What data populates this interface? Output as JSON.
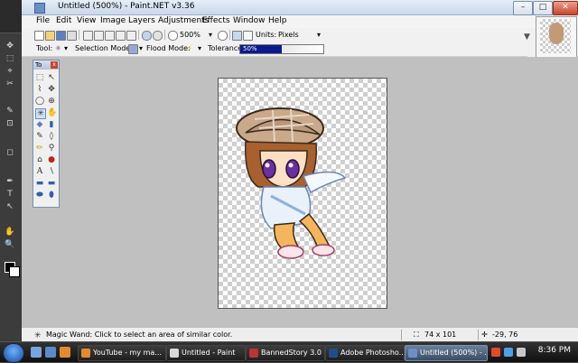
{
  "photoshop": {
    "tools": [
      "✥",
      "⬚",
      "⌖",
      "✂",
      "✎",
      "⊡",
      "◻",
      "✒",
      "T",
      "↖",
      "✋",
      "🔍"
    ]
  },
  "window": {
    "title": "Untitled (500%) - Paint.NET v3.36",
    "minimize": "–",
    "maximize": "□",
    "close": "✕"
  },
  "menu": [
    "File",
    "Edit",
    "View",
    "Image",
    "Layers",
    "Adjustments",
    "Effects",
    "Window",
    "Help"
  ],
  "toolbar": {
    "zoom_value": "500%",
    "units_label": "Units:",
    "units_value": "Pixels"
  },
  "toolbar2": {
    "tool_label": "Tool:",
    "selection_mode_label": "Selection Mode:",
    "flood_mode_label": "Flood Mode:",
    "tolerance_label": "Tolerance:",
    "tolerance_value": "50%",
    "tolerance_fraction": 0.5
  },
  "tools_window": {
    "title": "To",
    "close": "x"
  },
  "status": {
    "message": "Magic Wand: Click to select an area of similar color.",
    "image_size": "74 x 101",
    "cursor_position": "-29, 76"
  },
  "taskbar": {
    "items": [
      "YouTube - my ma...",
      "Untitled - Paint",
      "BannedStory 3.0",
      "Adobe Photosho...",
      "Untitled (500%) - ..."
    ],
    "clock": "8:36 PM"
  },
  "colors": {
    "accent": "#0b1a8c",
    "workspace": "#c0c0c0"
  }
}
